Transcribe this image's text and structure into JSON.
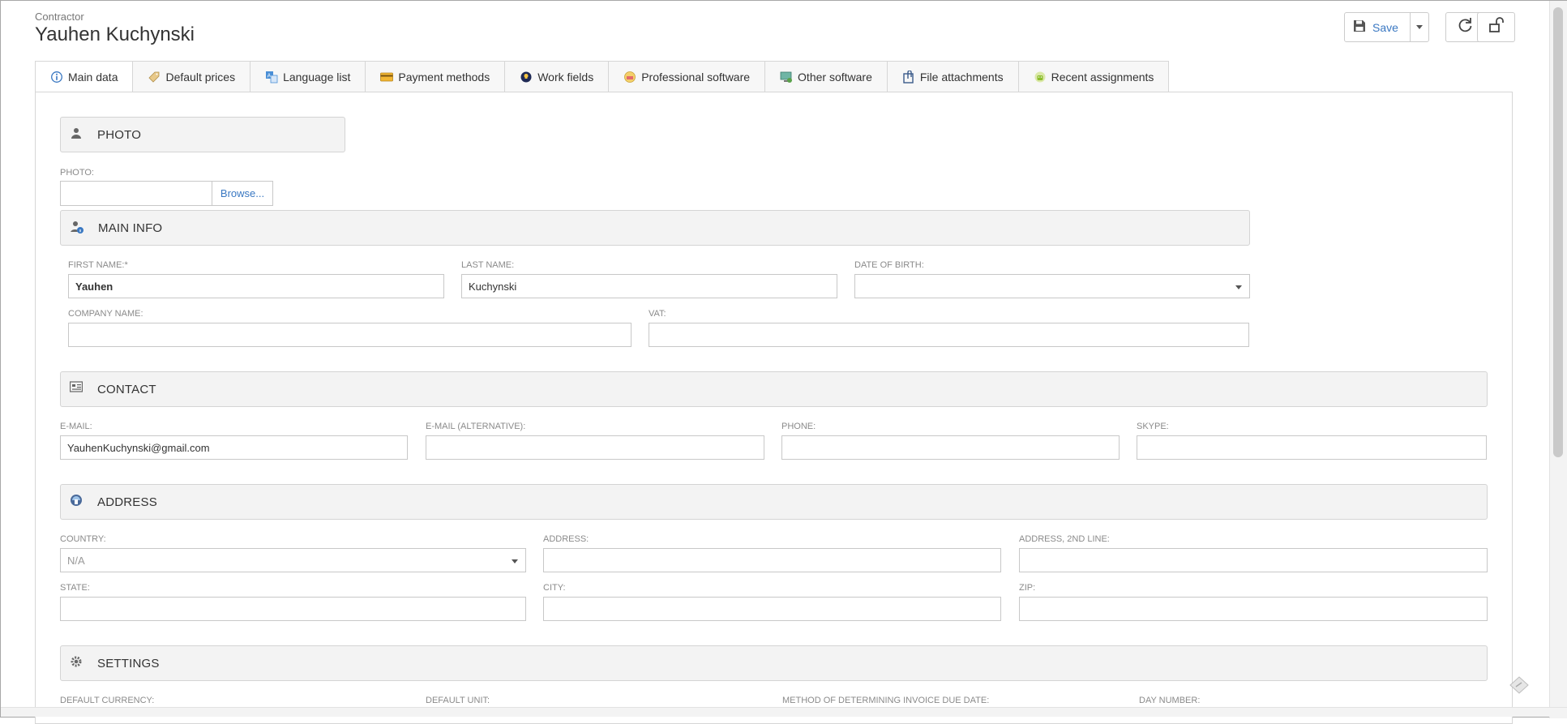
{
  "header": {
    "entity_label": "Contractor",
    "title": "Yauhen Kuchynski"
  },
  "toolbar": {
    "save_label": "Save",
    "save_icon": "floppy-disk-icon",
    "refresh_icon": "refresh-icon",
    "unlock_icon": "unlock-icon"
  },
  "tabs": [
    {
      "label": "Main data",
      "icon": "info-icon",
      "active": true
    },
    {
      "label": "Default prices",
      "icon": "price-tag-icon"
    },
    {
      "label": "Language list",
      "icon": "translate-icon"
    },
    {
      "label": "Payment methods",
      "icon": "credit-card-icon"
    },
    {
      "label": "Work fields",
      "icon": "lightbulb-icon"
    },
    {
      "label": "Professional software",
      "icon": "software-icon"
    },
    {
      "label": "Other software",
      "icon": "computer-icon"
    },
    {
      "label": "File attachments",
      "icon": "attachment-icon"
    },
    {
      "label": "Recent assignments",
      "icon": "android-icon"
    }
  ],
  "sections": {
    "photo": "PHOTO",
    "main_info": "MAIN INFO",
    "contact": "CONTACT",
    "address": "ADDRESS",
    "settings": "SETTINGS"
  },
  "photo": {
    "label": "PHOTO:",
    "browse_label": "Browse..."
  },
  "main_info": {
    "first_name_label": "FIRST NAME:*",
    "first_name_value": "Yauhen",
    "last_name_label": "LAST NAME:",
    "last_name_value": "Kuchynski",
    "dob_label": "DATE OF BIRTH:",
    "dob_value": "",
    "company_label": "COMPANY NAME:",
    "company_value": "",
    "vat_label": "VAT:",
    "vat_value": ""
  },
  "contact": {
    "email_label": "E-MAIL:",
    "email_value": "YauhenKuchynski@gmail.com",
    "email_alt_label": "E-MAIL (ALTERNATIVE):",
    "email_alt_value": "",
    "phone_label": "PHONE:",
    "phone_value": "",
    "skype_label": "SKYPE:",
    "skype_value": ""
  },
  "address": {
    "country_label": "COUNTRY:",
    "country_value": "N/A",
    "address_label": "ADDRESS:",
    "address_value": "",
    "address2_label": "ADDRESS, 2ND LINE:",
    "address2_value": "",
    "state_label": "STATE:",
    "state_value": "",
    "city_label": "CITY:",
    "city_value": "",
    "zip_label": "ZIP:",
    "zip_value": ""
  },
  "settings": {
    "currency_label": "DEFAULT CURRENCY:",
    "unit_label": "DEFAULT UNIT:",
    "due_method_label": "METHOD OF DETERMINING INVOICE DUE DATE:",
    "day_number_label": "DAY NUMBER:"
  }
}
